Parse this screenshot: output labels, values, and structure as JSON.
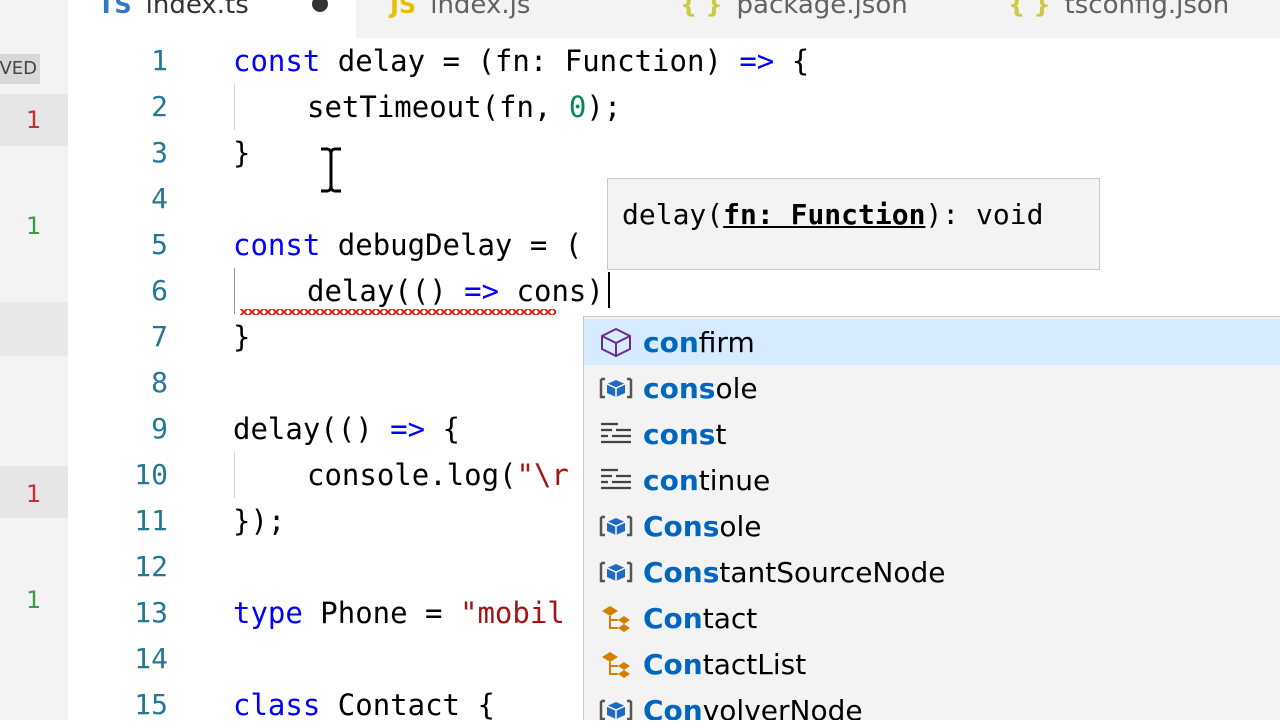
{
  "tabs": [
    {
      "icon": "TS",
      "label": "index.ts"
    },
    {
      "icon": "JS",
      "label": "index.js"
    },
    {
      "icon": "{ }",
      "label": "package.json"
    },
    {
      "icon": "{ }",
      "label": "tsconfig.json"
    }
  ],
  "scm": {
    "saved_label": "VED",
    "counts": [
      "1",
      "1",
      "1",
      "1"
    ]
  },
  "editor": {
    "line_numbers": [
      "1",
      "2",
      "3",
      "4",
      "5",
      "6",
      "7",
      "8",
      "9",
      "10",
      "11",
      "12",
      "13",
      "14",
      "15"
    ],
    "lines": {
      "l1a": "const",
      "l1b": " delay = (fn: Function) ",
      "l1c": "=>",
      "l1d": " {",
      "l2a": "setTimeout(fn, ",
      "l2b": "0",
      "l2c": ");",
      "l3": "}",
      "l5a": "const",
      "l5b": " debugDelay = (",
      "l6a": "delay(() ",
      "l6b": "=>",
      "l6c": " cons)",
      "l7": "}",
      "l9a": "delay(() ",
      "l9b": "=>",
      "l9c": " {",
      "l10a": "console.log(",
      "l10b": "\"\\r",
      "l11": "});",
      "l13a": "type",
      "l13b": " Phone = ",
      "l13c": "\"mobil",
      "l15a": "class",
      "l15b": " Contact {"
    }
  },
  "hover": {
    "prefix": "delay(",
    "param": "fn: Function",
    "suffix": "): void"
  },
  "suggestions": [
    {
      "icon": "cube-icon",
      "match": "con",
      "rest": "firm",
      "selected": true
    },
    {
      "icon": "variable-icon",
      "match": "cons",
      "rest": "ole"
    },
    {
      "icon": "keyword-icon",
      "match": "cons",
      "rest": "t"
    },
    {
      "icon": "keyword-icon",
      "match": "con",
      "rest": "tinue"
    },
    {
      "icon": "variable-icon",
      "match": "Cons",
      "rest": "ole"
    },
    {
      "icon": "variable-icon",
      "match": "Cons",
      "rest": "tantSourceNode"
    },
    {
      "icon": "class-icon",
      "match": "Con",
      "rest": "tact"
    },
    {
      "icon": "class-icon",
      "match": "Con",
      "rest": "tactList"
    },
    {
      "icon": "variable-icon",
      "match": "Con",
      "rest": "volverNode"
    }
  ],
  "colors": {
    "keyword": "#0000ff",
    "string": "#a31515",
    "number": "#098658",
    "line_number": "#237893",
    "match_highlight": "#0066bf",
    "selected_row": "#d6ebff",
    "error_squiggle": "#e51400"
  }
}
